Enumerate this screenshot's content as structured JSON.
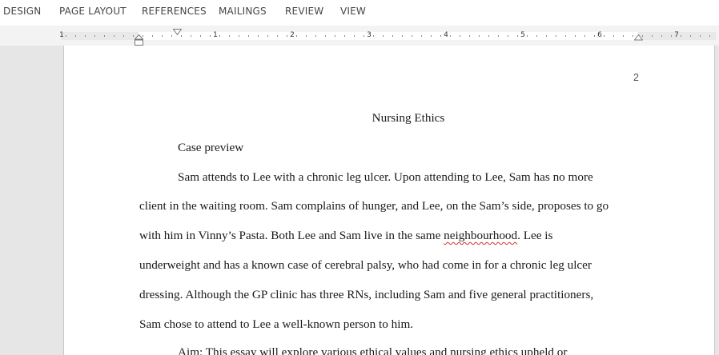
{
  "ribbon": {
    "tabs": [
      {
        "label": "DESIGN"
      },
      {
        "label": "PAGE LAYOUT"
      },
      {
        "label": "REFERENCES"
      },
      {
        "label": "MAILINGS"
      },
      {
        "label": "REVIEW"
      },
      {
        "label": "VIEW"
      }
    ]
  },
  "ruler": {
    "numbers": [
      "1",
      "1",
      "2",
      "3",
      "4",
      "5",
      "6",
      "7"
    ]
  },
  "document": {
    "page_number": "2",
    "title": "Nursing Ethics",
    "heading": "Case preview",
    "lines": [
      "Sam attends to Lee with a chronic leg ulcer. Upon attending to Lee, Sam has no more",
      "client in the waiting room. Sam complains of hunger, and Lee, on the Sam’s side, proposes to go",
      "with him in Vinny’s Pasta. Both Lee and Sam live in the same ",
      "underweight and has a known case of cerebral palsy, who had come in for a chronic leg ulcer",
      "dressing. Although the GP clinic has three RNs, including Sam and five general practitioners,",
      "Sam chose to attend to Lee a well-known person to him.",
      "Aim: This essay will explore various ethical values and nursing ethics upheld or"
    ],
    "misspelled_word": "neighbourhood",
    "line3_tail": ". Lee is"
  }
}
